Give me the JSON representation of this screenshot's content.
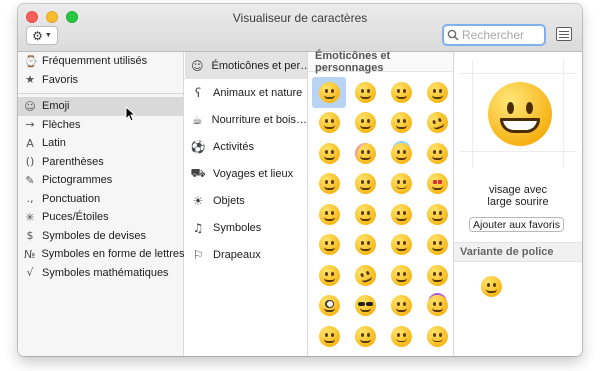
{
  "window": {
    "title": "Visualiseur de caractères"
  },
  "toolbar": {
    "gear_icon": "gear-icon",
    "search_placeholder": "Rechercher"
  },
  "sidebar": {
    "items": [
      {
        "icon": "clock-icon",
        "glyph": "⌚",
        "label": "Fréquemment utilisés"
      },
      {
        "icon": "star-icon",
        "glyph": "★",
        "label": "Favoris"
      },
      {
        "icon": "smiley-icon",
        "glyph": "☺",
        "label": "Emoji",
        "selected": true
      },
      {
        "icon": "arrow-icon",
        "glyph": "→",
        "label": "Flèches"
      },
      {
        "icon": "latin-a-icon",
        "glyph": "A",
        "label": "Latin"
      },
      {
        "icon": "parentheses-icon",
        "glyph": "()",
        "label": "Parenthèses"
      },
      {
        "icon": "pictogram-icon",
        "glyph": "✎",
        "label": "Pictogrammes"
      },
      {
        "icon": "punctuation-icon",
        "glyph": ".,",
        "label": "Ponctuation"
      },
      {
        "icon": "bullet-star-icon",
        "glyph": "✳",
        "label": "Puces/Étoiles"
      },
      {
        "icon": "dollar-icon",
        "glyph": "$",
        "label": "Symboles de devises"
      },
      {
        "icon": "numero-icon",
        "glyph": "№",
        "label": "Symboles en forme de lettres"
      },
      {
        "icon": "square-root-icon",
        "glyph": "√",
        "label": "Symboles mathématiques"
      }
    ]
  },
  "categories": {
    "items": [
      {
        "icon": "smiley-icon",
        "glyph": "☺",
        "label": "Émoticônes et per…",
        "selected": true
      },
      {
        "icon": "bear-icon",
        "glyph": "ʕ",
        "label": "Animaux et nature"
      },
      {
        "icon": "food-icon",
        "glyph": "☕",
        "label": "Nourriture et bois…"
      },
      {
        "icon": "ball-icon",
        "glyph": "⚽",
        "label": "Activités"
      },
      {
        "icon": "car-icon",
        "glyph": "⛟",
        "label": "Voyages et lieux"
      },
      {
        "icon": "lightbulb-icon",
        "glyph": "☀",
        "label": "Objets"
      },
      {
        "icon": "symbols-icon",
        "glyph": "♫",
        "label": "Symboles"
      },
      {
        "icon": "flag-icon",
        "glyph": "⚐",
        "label": "Drapeaux"
      }
    ]
  },
  "emoji_grid": {
    "heading": "Émoticônes et personnages",
    "rows": [
      [
        "grinning",
        "smiley",
        "smile",
        "grin"
      ],
      [
        "laughing",
        "sweat-smile",
        "joy",
        "rofl"
      ],
      [
        "relaxed",
        "blush",
        "halo",
        "slight-smile"
      ],
      [
        "upside-down",
        "wink",
        "relieved",
        "heart-eyes"
      ],
      [
        "smiling-hearts",
        "kissing-heart",
        "kissing",
        "kissing-smiling"
      ],
      [
        "kissing-closed",
        "yum",
        "tongue",
        "squint-tongue"
      ],
      [
        "winking-tongue",
        "zany",
        "raised-brow",
        "monocle"
      ],
      [
        "nerd",
        "cool",
        "star-struck",
        "party"
      ],
      [
        "smirk",
        "unamused",
        "disappointed",
        "pensive"
      ]
    ]
  },
  "detail": {
    "char_name_line1": "visage avec",
    "char_name_line2": "large sourire",
    "favorite_button": "Ajouter aux favoris",
    "variant_heading": "Variante de police"
  }
}
